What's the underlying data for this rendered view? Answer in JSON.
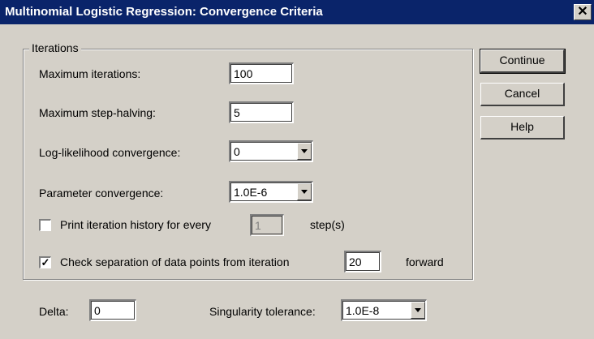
{
  "window": {
    "title": "Multinomial Logistic Regression: Convergence Criteria",
    "close_glyph": "✕"
  },
  "iterations": {
    "group_label": "Iterations",
    "max_iterations": {
      "label": "Maximum iterations:",
      "value": "100"
    },
    "max_step_halving": {
      "label": "Maximum step-halving:",
      "value": "5"
    },
    "loglik_convergence": {
      "label": "Log-likelihood convergence:",
      "value": "0"
    },
    "param_convergence": {
      "label": "Parameter convergence:",
      "value": "1.0E-6"
    },
    "print_history": {
      "label": "Print iteration history for every",
      "checked": false,
      "value": "1",
      "suffix": "step(s)"
    },
    "check_separation": {
      "label": "Check separation of data points from iteration",
      "checked": true,
      "value": "20",
      "suffix": "forward"
    }
  },
  "delta": {
    "label": "Delta:",
    "value": "0"
  },
  "singularity": {
    "label": "Singularity tolerance:",
    "value": "1.0E-8"
  },
  "buttons": {
    "continue": "Continue",
    "cancel": "Cancel",
    "help": "Help"
  }
}
